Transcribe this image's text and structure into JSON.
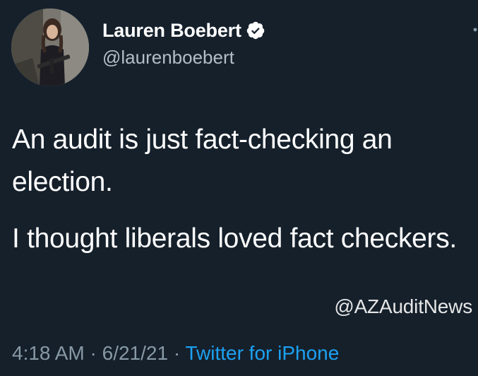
{
  "author": {
    "display_name": "Lauren Boebert",
    "handle": "@laurenboebert",
    "verified": true
  },
  "icons": {
    "verified": "verified-badge-icon",
    "more": "more-options-icon",
    "avatar": "profile-photo"
  },
  "tweet": {
    "paragraphs": [
      "An audit is just fact-checking an election.",
      "I thought liberals loved fact checkers."
    ]
  },
  "meta": {
    "time": "4:18 AM",
    "separator1": " · ",
    "date": "6/21/21",
    "separator2": " · ",
    "source": "Twitter for iPhone"
  },
  "watermark": "@AZAuditNews",
  "colors": {
    "background": "#15202b",
    "text": "#ffffff",
    "muted": "#8899a6",
    "accent": "#1da1f2"
  }
}
